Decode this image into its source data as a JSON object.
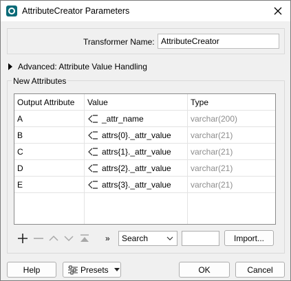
{
  "window": {
    "title": "AttributeCreator Parameters"
  },
  "transformer": {
    "name_label": "Transformer Name:",
    "name_value": "AttributeCreator"
  },
  "advanced": {
    "label": "Advanced: Attribute Value Handling"
  },
  "new_attributes": {
    "group_label": "New Attributes",
    "columns": [
      "Output Attribute",
      "Value",
      "Type"
    ],
    "rows": [
      {
        "output": "A",
        "value": "_attr_name",
        "type": "varchar(200)"
      },
      {
        "output": "B",
        "value": "attrs{0}._attr_value",
        "type": "varchar(21)"
      },
      {
        "output": "C",
        "value": "attrs{1}._attr_value",
        "type": "varchar(21)"
      },
      {
        "output": "D",
        "value": "attrs{2}._attr_value",
        "type": "varchar(21)"
      },
      {
        "output": "E",
        "value": "attrs{3}._attr_value",
        "type": "varchar(21)"
      }
    ]
  },
  "toolbar": {
    "search_value": "Search",
    "import_label": "Import...",
    "more_glyph": "»",
    "icons": [
      "add-icon",
      "remove-icon",
      "move-up-icon",
      "move-down-icon",
      "move-top-icon"
    ]
  },
  "footer": {
    "help_label": "Help",
    "presets_label": "Presets",
    "ok_label": "OK",
    "cancel_label": "Cancel"
  }
}
